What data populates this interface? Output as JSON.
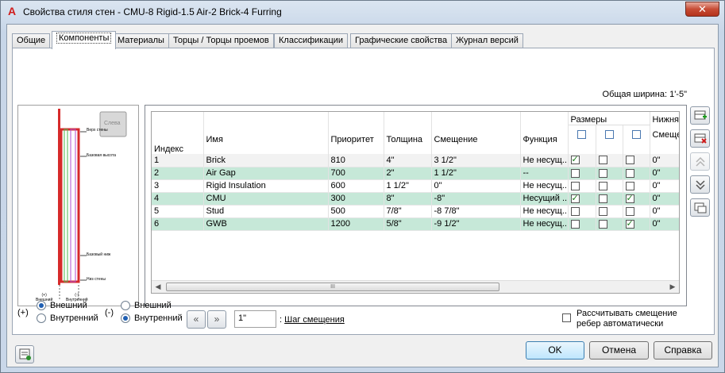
{
  "window": {
    "title": "Свойства стиля стен - CMU-8 Rigid-1.5 Air-2 Brick-4 Furring",
    "close_label": "✕"
  },
  "tabs": [
    {
      "label": "Общие"
    },
    {
      "label": "Компоненты",
      "active": true
    },
    {
      "label": "Материалы"
    },
    {
      "label": "Торцы / Торцы проемов"
    },
    {
      "label": "Классификации"
    },
    {
      "label": "Графические свойства"
    },
    {
      "label": "Журнал версий"
    }
  ],
  "total_width": "Общая ширина: 1'-5\"",
  "preview": {
    "view_label": "Слева",
    "labels": [
      "Верх стены",
      "Базовая высота",
      "Базовый ниж",
      "Низ стены"
    ],
    "bottom_left": "(+)\nВнешний",
    "bottom_right": "(-)\nВнутренний"
  },
  "grid": {
    "group_header": "Размеры",
    "group_header_2": "Нижняя",
    "columns": [
      "Индекс",
      "Имя",
      "Приоритет",
      "Толщина",
      "Смещение",
      "Функция",
      "",
      "",
      "",
      "Смещен"
    ],
    "rows": [
      {
        "index": "1",
        "name": "Brick",
        "priority": "810",
        "thickness": "4\"",
        "offset": "3 1/2\"",
        "function": "Не несущ...",
        "c1": true,
        "c2": false,
        "c3": false,
        "bottom": "0\""
      },
      {
        "index": "2",
        "name": "Air Gap",
        "priority": "700",
        "thickness": "2\"",
        "offset": "1 1/2\"",
        "function": "--",
        "c1": false,
        "c2": false,
        "c3": false,
        "bottom": "0\""
      },
      {
        "index": "3",
        "name": "Rigid Insulation",
        "priority": "600",
        "thickness": "1 1/2\"",
        "offset": "0\"",
        "function": "Не несущ...",
        "c1": false,
        "c2": false,
        "c3": false,
        "bottom": "0\""
      },
      {
        "index": "4",
        "name": "CMU",
        "priority": "300",
        "thickness": "8\"",
        "offset": "-8\"",
        "function": "Несущий ...",
        "c1": true,
        "c2": false,
        "c3": true,
        "bottom": "0\""
      },
      {
        "index": "5",
        "name": "Stud",
        "priority": "500",
        "thickness": "7/8\"",
        "offset": "-8 7/8\"",
        "function": "Не несущ...",
        "c1": false,
        "c2": false,
        "c3": false,
        "bottom": "0\""
      },
      {
        "index": "6",
        "name": "GWB",
        "priority": "1200",
        "thickness": "5/8\"",
        "offset": "-9 1/2\"",
        "function": "Не несущ...",
        "c1": false,
        "c2": false,
        "c3": true,
        "bottom": "0\""
      }
    ],
    "scroll_grip": "III"
  },
  "side_buttons": [
    "add-component-icon",
    "delete-component-icon",
    "move-up-icon",
    "move-down-icon",
    "copy-component-icon"
  ],
  "bottom": {
    "plus_label": "(+)",
    "minus_label": "(-)",
    "left_options": [
      "Внешний",
      "Внутренний"
    ],
    "left_selected": 0,
    "right_options": [
      "Внешний",
      "Внутренний"
    ],
    "right_selected": 1,
    "offset_value": "1\"",
    "offset_step_label": "Шаг смещения",
    "recalc_label_1": "Рассчитывать смещение",
    "recalc_label_2": "ребер автоматически"
  },
  "buttons": {
    "ok": "OK",
    "cancel": "Отмена",
    "help": "Справка"
  },
  "colors": {
    "alt_row": "#c6e8d8",
    "accent": "#d01c1c"
  }
}
